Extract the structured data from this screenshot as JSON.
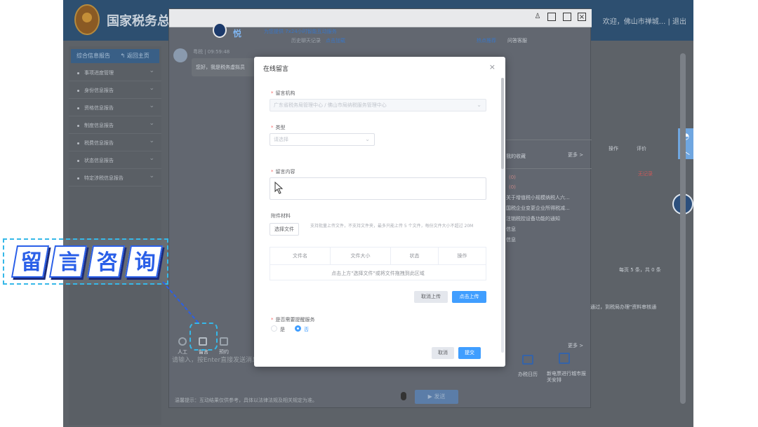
{
  "background": {
    "site_title": "国家税务总局",
    "welcome": "欢迎，佛山市禅城... | 退出",
    "sidebar_head": "综合信息报告",
    "sidebar_back": "返回主页",
    "sidebar_items": [
      "事项进度管理",
      "身份信息报告",
      "资格信息报告",
      "制度信息报告",
      "税费信息报告",
      "状态信息报告",
      "特定涉税信息报告"
    ]
  },
  "chat": {
    "brand": "悦",
    "tagline": "为您提供 7x24小时智能互动服务",
    "history_link": "历史聊天记录",
    "more_link": "点击加载",
    "hot_tab": "热点推荐",
    "faq_tab": "问答客服",
    "sender_time": "粤税 | 09:59:48",
    "greeting": "您好，我是税务虚拟员",
    "favorites": "我的收藏",
    "more": "更多 >",
    "col_action": "操作",
    "col_eval": "评价",
    "eval_status": "无记录",
    "pager": "每页 5 条，共 0 条",
    "list_items": [
      "(0)",
      "(0)",
      "关于增值税小规模纳税人六...",
      "国税企业变更企业所得税减...",
      "注销税控设备功能的通知",
      "信息",
      "信息"
    ],
    "hint": "请输入，按Enter直接发送消息",
    "toolbar": [
      {
        "label": "人工"
      },
      {
        "label": "留言"
      },
      {
        "label": "预约"
      }
    ],
    "bottom_tip": "温馨提示：互动结果仅供参考，具体以法律法规及相关规定为准。",
    "send": "发送",
    "right_links": [
      "办税日历",
      "新电票进行城市报关安排"
    ],
    "note_line": "通过，到税局办理\"资料审核通"
  },
  "callout": {
    "chars": [
      "留",
      "言",
      "咨",
      "询"
    ]
  },
  "modal": {
    "title": "在线留言",
    "org_label": "留言机构",
    "org_value": "广东省税务局管理中心 / 佛山市局纳税服务管理中心",
    "type_label": "类型",
    "type_placeholder": "请选择",
    "content_label": "留言内容",
    "attach_label": "附件材料",
    "choose_file": "选择文件",
    "upload_note": "支持批量上传文件，不支持文件夹，最多只能上传 5 个文件，每份文件大小不超过 20M",
    "table_headers": [
      "文件名",
      "文件大小",
      "状态",
      "操作"
    ],
    "table_empty": "点击上方\"选择文件\"或将文件拖拽到此区域",
    "cancel_upload": "取消上传",
    "start_upload": "点击上传",
    "reminder_label": "是否需要提醒服务",
    "radio_yes": "是",
    "radio_no": "否",
    "cancel": "取消",
    "submit": "提交"
  },
  "colors": {
    "primary": "#409eff",
    "callout_blue": "#2a5fe8",
    "dash": "#36b8e8",
    "danger": "#f56c6c"
  }
}
